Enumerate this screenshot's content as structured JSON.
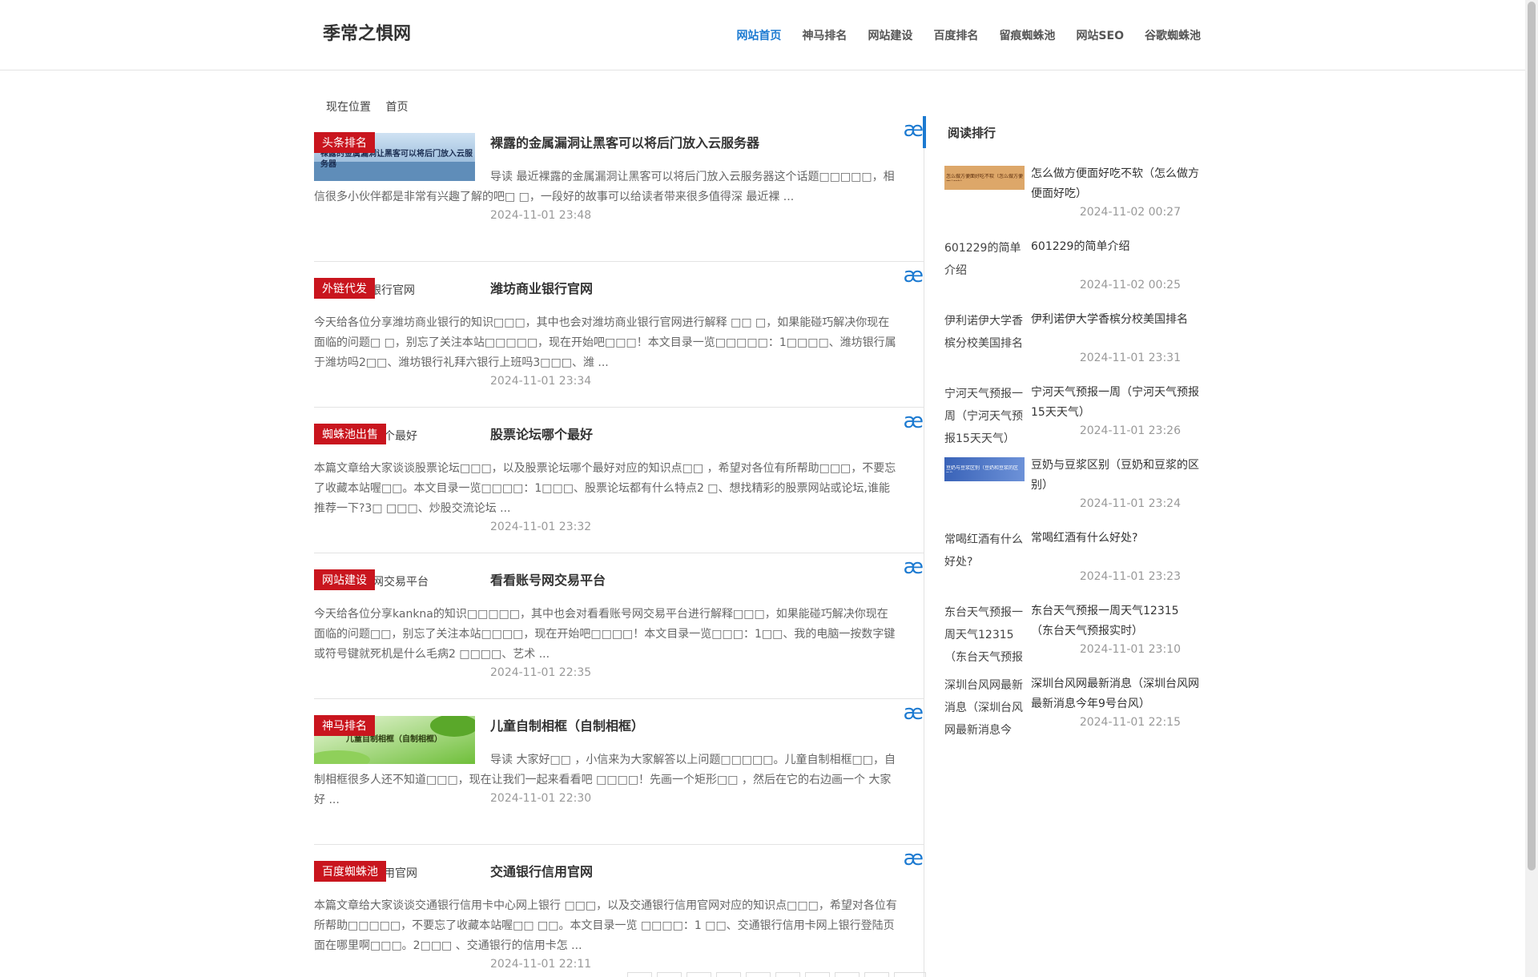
{
  "site": {
    "title": "季常之惧网"
  },
  "nav": [
    {
      "label": "网站首页",
      "active": true
    },
    {
      "label": "神马排名"
    },
    {
      "label": "网站建设"
    },
    {
      "label": "百度排名"
    },
    {
      "label": "留痕蜘蛛池"
    },
    {
      "label": "网站SEO"
    },
    {
      "label": "谷歌蜘蛛池"
    }
  ],
  "breadcrumb": {
    "prefix": "现在位置",
    "home": "首页"
  },
  "articles": [
    {
      "tag": "头条排名",
      "thumb_text": "裸露的金属漏洞让黑客可以将后门放入云服务器",
      "thumb_alt": "",
      "title": "裸露的金属漏洞让黑客可以将后门放入云服务器",
      "excerpt": "导读 最近裸露的金属漏洞让黑客可以将后门放入云服务器这个话题□□□□□，相信很多小伙伴都是非常有兴趣了解的吧□ □，一段好的故事可以给读者带来很多值得深 最近裸 ...",
      "date": "2024-11-01 23:48"
    },
    {
      "tag": "外链代发",
      "thumb_text": "",
      "thumb_alt": "银行官网",
      "title": "潍坊商业银行官网",
      "excerpt": "今天给各位分享潍坊商业银行的知识□□□，其中也会对潍坊商业银行官网进行解释 □□ □，如果能碰巧解决你现在面临的问题□ □，别忘了关注本站□□□□□，现在开始吧□□□！本文目录一览□□□□□：1□□□□、潍坊银行属于潍坊吗2□□、潍坊银行礼拜六银行上班吗3□□□、潍 ...",
      "date": "2024-11-01 23:34"
    },
    {
      "tag": "蜘蛛池出售",
      "thumb_text": "",
      "thumb_alt": "个最好",
      "title": "股票论坛哪个最好",
      "excerpt": "本篇文章给大家谈谈股票论坛□□□，以及股票论坛哪个最好对应的知识点□□ ，希望对各位有所帮助□□□，不要忘了收藏本站喔□□。本文目录一览□□□□：1□□□、股票论坛都有什么特点2 □、想找精彩的股票网站或论坛,谁能推荐一下?3□ □□□、炒股交流论坛 ...",
      "date": "2024-11-01 23:32"
    },
    {
      "tag": "网站建设",
      "thumb_text": "",
      "thumb_alt": "网交易平台",
      "title": "看看账号网交易平台",
      "excerpt": "今天给各位分享kankna的知识□□□□□，其中也会对看看账号网交易平台进行解释□□□，如果能碰巧解决你现在面临的问题□□，别忘了关注本站□□□□，现在开始吧□□□□！本文目录一览□□□：1□□、我的电脑一按数字键或符号键就死机是什么毛病2 □□□□、艺术 ...",
      "date": "2024-11-01 22:35"
    },
    {
      "tag": "神马排名",
      "thumb_text": "儿童自制相框（自制相框）",
      "thumb_alt": "",
      "title": "儿童自制相框（自制相框）",
      "excerpt": "导读 大家好□□ ，小信来为大家解答以上问题□□□□□。儿童自制相框□□，自制相框很多人还不知道□□□，现在让我们一起来看看吧 □□□□！先画一个矩形□□ ，然后在它的右边画一个 大家好 ...",
      "date": "2024-11-01 22:30"
    },
    {
      "tag": "百度蜘蛛池",
      "thumb_text": "",
      "thumb_alt": "用官网",
      "title": "交通银行信用官网",
      "excerpt": "本篇文章给大家谈谈交通银行信用卡中心网上银行 □□□，以及交通银行信用官网对应的知识点□□□，希望对各位有所帮助□□□□□，不要忘了收藏本站喔□□ □□。本文目录一览 □□□□：1 □□、交通银行信用卡网上银行登陆页面在哪里啊□□□。2□□□ 、交通银行的信用卡怎 ...",
      "date": "2024-11-01 22:11"
    }
  ],
  "ae_glyph": "æ",
  "sidebar": {
    "title": "阅读排行",
    "items": [
      {
        "thumb_alt": "",
        "thumb_text": "怎么做方便面好吃不软（怎么做方便面好吃）",
        "title": "怎么做方便面好吃不软（怎么做方便面好吃）",
        "date": "2024-11-02 00:27"
      },
      {
        "thumb_alt": "601229的简单介绍",
        "thumb_text": "",
        "title": "601229的简单介绍",
        "date": "2024-11-02 00:25"
      },
      {
        "thumb_alt": "伊利诺伊大学香槟分校美国排名",
        "thumb_text": "",
        "title": "伊利诺伊大学香槟分校美国排名",
        "date": "2024-11-01 23:31"
      },
      {
        "thumb_alt": "宁河天气预报一周（宁河天气预报15天天气）",
        "thumb_text": "",
        "title": "宁河天气预报一周（宁河天气预报15天天气）",
        "date": "2024-11-01 23:26"
      },
      {
        "thumb_alt": "",
        "thumb_text": "豆奶与豆浆区别（豆奶和豆浆的区别）",
        "title": "豆奶与豆浆区别（豆奶和豆浆的区别）",
        "date": "2024-11-01 23:24"
      },
      {
        "thumb_alt": "常喝红酒有什么好处?",
        "thumb_text": "",
        "title": "常喝红酒有什么好处?",
        "date": "2024-11-01 23:23"
      },
      {
        "thumb_alt": "东台天气预报一周天气12315（东台天气预报",
        "thumb_text": "",
        "title": "东台天气预报一周天气12315（东台天气预报实时）",
        "date": "2024-11-01 23:10"
      },
      {
        "thumb_alt": "深圳台风网最新消息（深圳台风网最新消息今",
        "thumb_text": "",
        "title": "深圳台风网最新消息（深圳台风网最新消息今年9号台风）",
        "date": "2024-11-01 22:15"
      }
    ]
  },
  "colors": {
    "accent": "#1c7ad1",
    "tag": "#c9151e"
  }
}
